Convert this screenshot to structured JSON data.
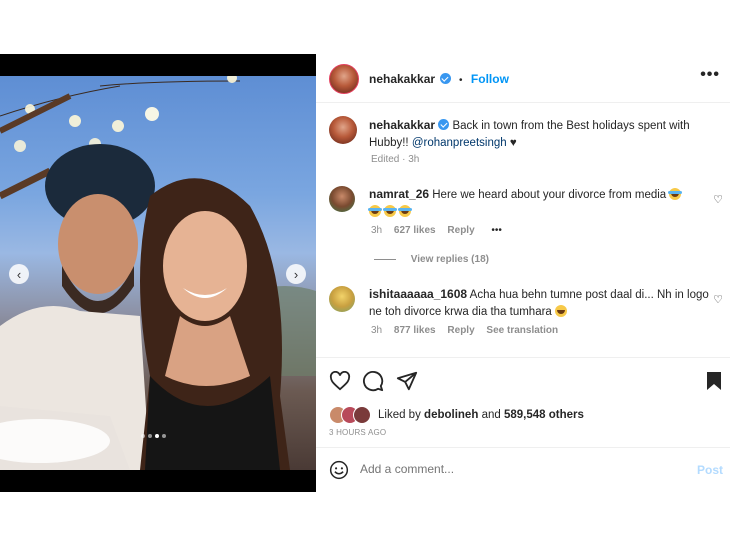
{
  "colors": {
    "accent": "#0095f6",
    "verified": "#3897f0",
    "text": "#262626",
    "muted": "#8e8e8e",
    "link": "#00376b"
  },
  "header": {
    "username": "nehakakkar",
    "separator": "•",
    "follow_label": "Follow",
    "more_icon": "more-horizontal-icon"
  },
  "caption": {
    "username": "nehakakkar",
    "text": "Back in town from the Best holidays spent with Hubby!!",
    "mention": "@rohanpreetsingh",
    "suffix": "♥",
    "meta": "Edited · 3h"
  },
  "comments": [
    {
      "username": "namrat_26",
      "text": "Here we heard about your divorce from media",
      "time": "3h",
      "likes": "627 likes",
      "reply_label": "Reply",
      "more": "•••",
      "view_replies": "View replies (18)"
    },
    {
      "username": "ishitaaaaaa_1608",
      "text": "Acha hua behn tumne post daal di... Nh in logo ne toh divorce krwa dia tha tumhara",
      "time": "3h",
      "likes": "877 likes",
      "reply_label": "Reply",
      "translation_label": "See translation"
    }
  ],
  "likes": {
    "prefix": "Liked by",
    "user": "debolineh",
    "connector": "and",
    "count": "589,548 others"
  },
  "timestamp": "3 HOURS AGO",
  "add_comment": {
    "placeholder": "Add a comment...",
    "post_label": "Post"
  },
  "media": {
    "carousel_count": 4,
    "active_index": 2
  }
}
